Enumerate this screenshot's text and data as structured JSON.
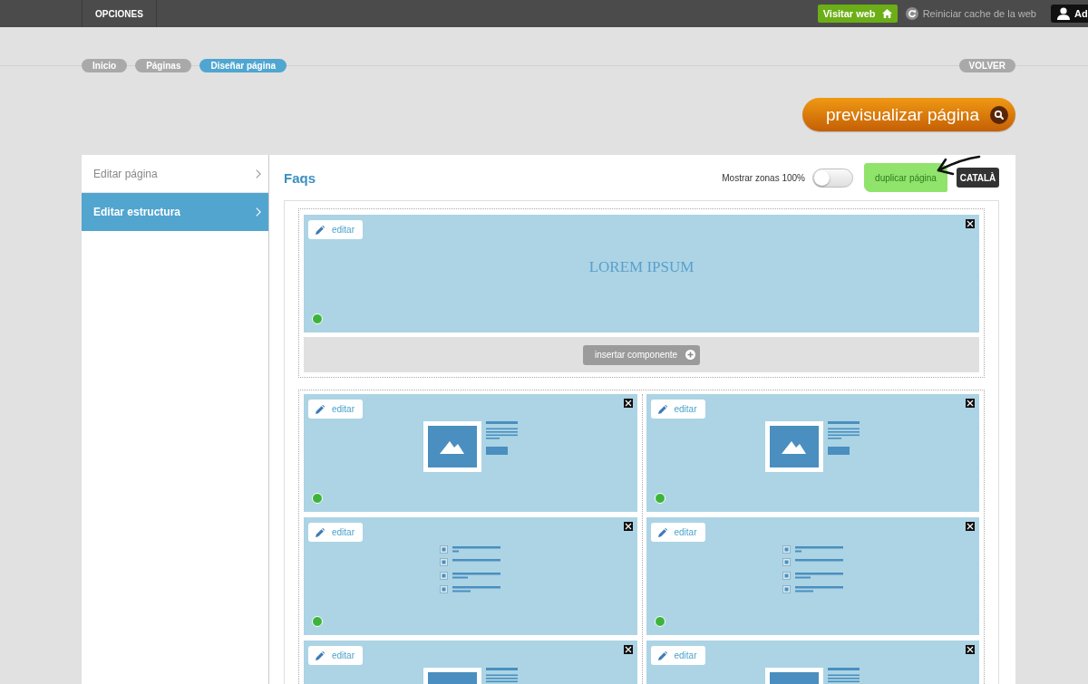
{
  "top_bar": {
    "menu_tab": "OPCIONES",
    "visit_button": "Visitar web",
    "cache_link": "Reiniciar cache de la web",
    "user_button": "Ad"
  },
  "breadcrumbs": [
    {
      "label": "Inicio",
      "selected": false
    },
    {
      "label": "Páginas",
      "selected": false
    },
    {
      "label": "Diseñar página",
      "selected": true
    }
  ],
  "back_button": "VOLVER",
  "preview_button": "previsualizar página",
  "sidebar": {
    "items": [
      {
        "label": "Editar página",
        "selected": false
      },
      {
        "label": "Editar estructura",
        "selected": true
      }
    ]
  },
  "editor": {
    "title": "Faqs",
    "zones_toggle": {
      "label": "Mostrar zonas 100%",
      "on": false
    },
    "duplicate_button": {
      "label": "duplicar página",
      "highlighted": true
    },
    "language_button": "CATALÀ",
    "rows": [
      {
        "columns": [
          {
            "blocks": [
              {
                "kind": "heading",
                "edit": "editar",
                "text": "LOREM IPSUM",
                "visible": true
              }
            ]
          }
        ],
        "insert_button": "insertar componente"
      },
      {
        "columns": [
          {
            "blocks": [
              {
                "kind": "image-text",
                "edit": "editar",
                "visible": true
              },
              {
                "kind": "list",
                "edit": "editar",
                "visible": true
              },
              {
                "kind": "image-text",
                "edit": "editar"
              }
            ]
          },
          {
            "blocks": [
              {
                "kind": "image-text",
                "edit": "editar",
                "visible": true
              },
              {
                "kind": "list",
                "edit": "editar",
                "visible": true
              },
              {
                "kind": "image-text",
                "edit": "editar"
              }
            ]
          }
        ]
      }
    ]
  }
}
